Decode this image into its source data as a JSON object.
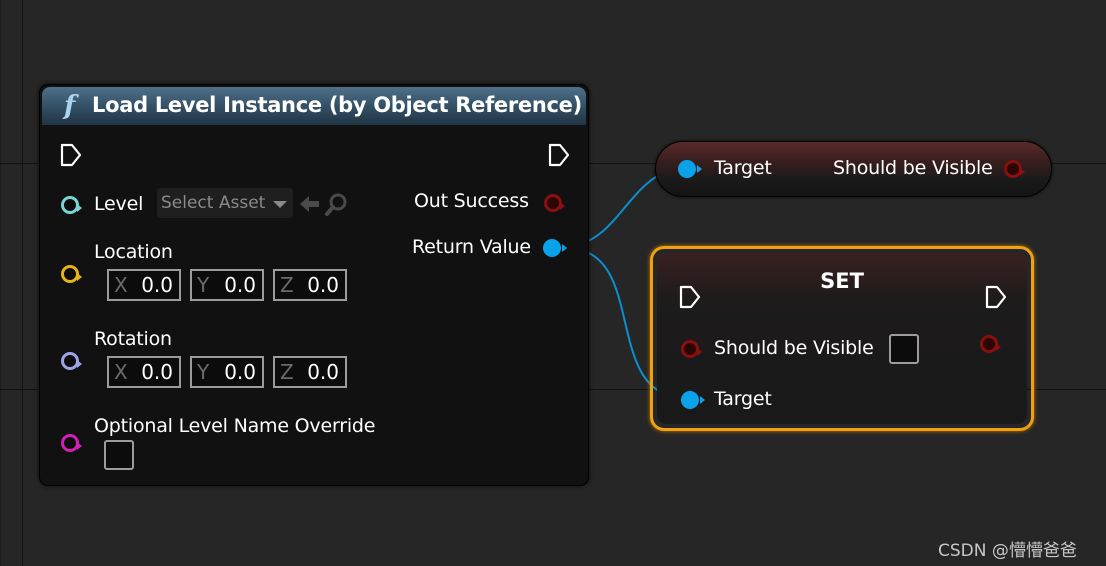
{
  "function_node": {
    "icon": "function-icon",
    "title": "Load Level Instance (by Object Reference)",
    "inputs": {
      "level_label": "Level",
      "asset_select": "Select Asset",
      "location_label": "Location",
      "location": {
        "x_axis": "X",
        "x": "0.0",
        "y_axis": "Y",
        "y": "0.0",
        "z_axis": "Z",
        "z": "0.0"
      },
      "rotation_label": "Rotation",
      "rotation": {
        "x_axis": "X",
        "x": "0.0",
        "y_axis": "Y",
        "y": "0.0",
        "z_axis": "Z",
        "z": "0.0"
      },
      "override_label": "Optional Level Name Override"
    },
    "outputs": {
      "out_success": "Out Success",
      "return_value": "Return Value"
    }
  },
  "get_node": {
    "target_label": "Target",
    "output_label": "Should be Visible"
  },
  "set_node": {
    "title": "SET",
    "should_be_visible_label": "Should be Visible",
    "target_label": "Target"
  },
  "watermark": "CSDN @懵懵爸爸",
  "colors": {
    "object_pin": "#0aa3ea",
    "bool_pin": "#8a0f0f",
    "vector_pin": "#e6b31d",
    "rotator_pin": "#9ca3e6",
    "name_pin": "#d11fb8",
    "soft_ref_pin": "#7ad3d6",
    "set_highlight": "#f0a010"
  }
}
